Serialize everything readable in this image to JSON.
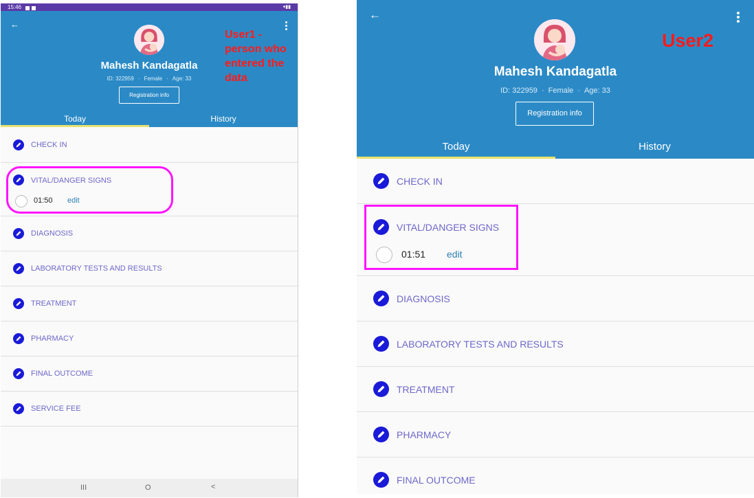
{
  "status_bar": {
    "time": "15:46"
  },
  "patient": {
    "name": "Mahesh Kandagatla",
    "id": "ID: 322959",
    "sex": "Female",
    "age": "Age: 33",
    "registration_button": "Registration info",
    "avatar_icon": "mother-baby-avatar-icon"
  },
  "tabs": {
    "today": "Today",
    "history": "History"
  },
  "sections": [
    "CHECK IN",
    "VITAL/DANGER SIGNS",
    "DIAGNOSIS",
    "LABORATORY TESTS AND RESULTS",
    "TREATMENT",
    "PHARMACY",
    "FINAL OUTCOME",
    "SERVICE FEE"
  ],
  "user1": {
    "annotation": "User1 - person who entered the data",
    "vital_time": "01:50",
    "edit_label": "edit"
  },
  "user2": {
    "annotation": "User2",
    "vital_time": "01:51",
    "edit_label": "edit"
  },
  "colors": {
    "header": "#2b8ac6",
    "edit_icon": "#1a1ad8",
    "highlight": "#ff14ff",
    "annotation": "#ff1a1a",
    "tab_indicator": "#e8e26c"
  },
  "nav_bar": {
    "recents": "III",
    "home": "O",
    "back": "<"
  }
}
